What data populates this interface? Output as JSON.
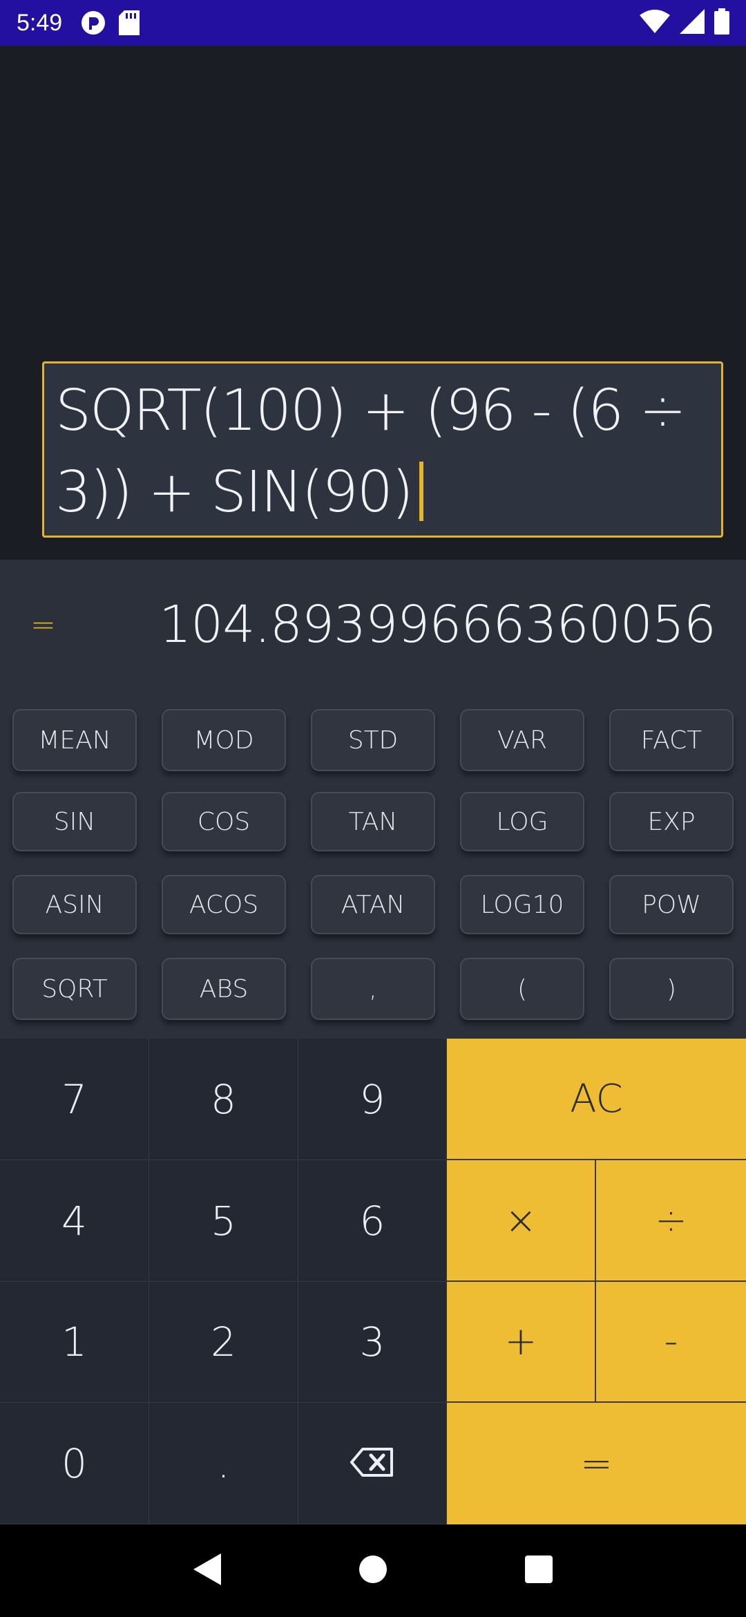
{
  "status_bar": {
    "time": "5:49",
    "left_icons": [
      "sync-icon",
      "sd-card-icon"
    ],
    "right_icons": [
      "wifi-icon",
      "signal-icon",
      "battery-icon"
    ]
  },
  "expression": {
    "text": "SQRT(100) + (96 - (6 ÷ 3)) + SIN(90)"
  },
  "result": {
    "equals_symbol": "=",
    "value": "104.89399666360056"
  },
  "functions": {
    "row1": [
      "MEAN",
      "MOD",
      "STD",
      "VAR",
      "FACT"
    ],
    "row2": [
      "SIN",
      "COS",
      "TAN",
      "LOG",
      "EXP"
    ],
    "row3": [
      "ASIN",
      "ACOS",
      "ATAN",
      "LOG10",
      "POW"
    ],
    "row4": [
      "SQRT",
      "ABS",
      ",",
      "(",
      ")"
    ]
  },
  "numpad": {
    "seven": "7",
    "eight": "8",
    "nine": "9",
    "ac": "AC",
    "four": "4",
    "five": "5",
    "six": "6",
    "multiply": "×",
    "divide": "÷",
    "one": "1",
    "two": "2",
    "three": "3",
    "plus": "+",
    "minus": "-",
    "zero": "0",
    "dot": ".",
    "backspace_icon": "backspace-icon",
    "equals": "="
  },
  "nav_bar": {
    "icons": [
      "back-icon",
      "home-icon",
      "recents-icon"
    ]
  },
  "colors": {
    "accent": "#e5b42a",
    "status_bar": "#2410a0",
    "operator_keys": "#efbd33"
  }
}
